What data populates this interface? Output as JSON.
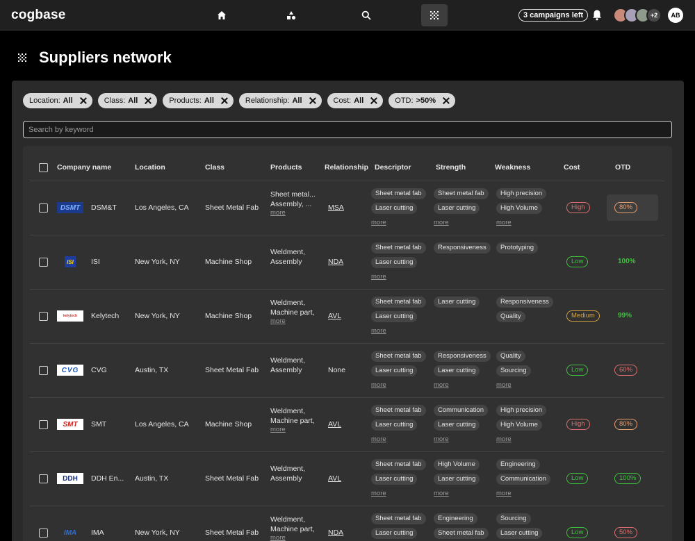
{
  "app": {
    "logo": "cogbase",
    "campaigns": "3 campaigns left",
    "avatars_more": "+2",
    "user_initials": "AB"
  },
  "page": {
    "title": "Suppliers network"
  },
  "filters": [
    {
      "label": "Location:",
      "value": "All"
    },
    {
      "label": "Class:",
      "value": "All"
    },
    {
      "label": "Products:",
      "value": "All"
    },
    {
      "label": "Relationship:",
      "value": "All"
    },
    {
      "label": "Cost:",
      "value": "All"
    },
    {
      "label": "OTD:",
      "value": ">50%"
    }
  ],
  "search": {
    "placeholder": "Search by keyword"
  },
  "columns": {
    "company": "Company name",
    "location": "Location",
    "class": "Class",
    "products": "Products",
    "relationship": "Relationship",
    "descriptor": "Descriptor",
    "strength": "Strength",
    "weakness": "Weakness",
    "cost": "Cost",
    "otd": "OTD"
  },
  "more_label": "more",
  "colors": {
    "high": "#e07070",
    "low": "#3ec23e",
    "medium": "#d6a23c",
    "otd_orange": "#e8a070",
    "otd_red": "#e07070",
    "otd_green": "#3ec23e"
  },
  "rows": [
    {
      "logo_text": "DSMT",
      "name": "DSM&T",
      "location": "Los Angeles, CA",
      "class": "Sheet Metal Fab",
      "products": [
        "Sheet metal...",
        "Assembly, ..."
      ],
      "products_more": true,
      "relationship": "MSA",
      "descriptor": [
        "Sheet metal fab",
        "Laser cutting"
      ],
      "descriptor_more": true,
      "strength": [
        "Sheet metal fab",
        "Laser cutting"
      ],
      "strength_more": true,
      "weakness": [
        "High precision",
        "High Volume"
      ],
      "weakness_more": true,
      "cost": "High",
      "otd": "80%"
    },
    {
      "logo_text": "ISI",
      "name": "ISI",
      "location": "New York, NY",
      "class": "Machine Shop",
      "products": [
        "Weldment,",
        "Assembly"
      ],
      "products_more": false,
      "relationship": "NDA",
      "descriptor": [
        "Sheet metal fab",
        "Laser cutting"
      ],
      "descriptor_more": true,
      "strength": [
        "Responsiveness"
      ],
      "strength_more": false,
      "weakness": [
        "Prototyping"
      ],
      "weakness_more": false,
      "cost": "Low",
      "otd": "100%"
    },
    {
      "logo_text": "kelytech",
      "name": "Kelytech",
      "location": "New York, NY",
      "class": "Machine Shop",
      "products": [
        "Weldment,",
        "Machine part,"
      ],
      "products_more": true,
      "relationship": "AVL",
      "descriptor": [
        "Sheet metal fab",
        "Laser cutting"
      ],
      "descriptor_more": true,
      "strength": [
        "Laser cutting"
      ],
      "strength_more": false,
      "weakness": [
        "Responsiveness",
        "Quality"
      ],
      "weakness_more": false,
      "cost": "Medium",
      "otd": "99%"
    },
    {
      "logo_text": "CVG",
      "name": "CVG",
      "location": "Austin, TX",
      "class": "Sheet Metal Fab",
      "products": [
        "Weldment,",
        "Assembly"
      ],
      "products_more": false,
      "relationship": "None",
      "descriptor": [
        "Sheet metal fab",
        "Laser cutting"
      ],
      "descriptor_more": true,
      "strength": [
        "Responsiveness",
        "Laser cutting"
      ],
      "strength_more": true,
      "weakness": [
        "Quality",
        "Sourcing"
      ],
      "weakness_more": true,
      "cost": "Low",
      "otd": "60%"
    },
    {
      "logo_text": "SMT",
      "name": "SMT",
      "location": "Los Angeles, CA",
      "class": "Machine Shop",
      "products": [
        "Weldment,",
        "Machine part,"
      ],
      "products_more": true,
      "relationship": "AVL",
      "descriptor": [
        "Sheet metal fab",
        "Laser cutting"
      ],
      "descriptor_more": true,
      "strength": [
        "Communication",
        "Laser cutting"
      ],
      "strength_more": true,
      "weakness": [
        "High precision",
        "High Volume"
      ],
      "weakness_more": true,
      "cost": "High",
      "otd": "80%"
    },
    {
      "logo_text": "DDH",
      "name": "DDH En...",
      "location": "Austin, TX",
      "class": "Sheet Metal Fab",
      "products": [
        "Weldment,",
        "Assembly"
      ],
      "products_more": false,
      "relationship": "AVL",
      "descriptor": [
        "Sheet metal fab",
        "Laser cutting"
      ],
      "descriptor_more": true,
      "strength": [
        "High Volume",
        "Laser cutting"
      ],
      "strength_more": true,
      "weakness": [
        "Engineering",
        "Communication"
      ],
      "weakness_more": true,
      "cost": "Low",
      "otd": "100%"
    },
    {
      "logo_text": "IMA",
      "name": "IMA",
      "location": "New York, NY",
      "class": "Sheet Metal Fab",
      "products": [
        "Weldment,",
        "Machine part,"
      ],
      "products_more": true,
      "relationship": "NDA",
      "descriptor": [
        "Sheet metal fab",
        "Laser cutting"
      ],
      "descriptor_more": false,
      "strength": [
        "Engineering",
        "Sheet metal fab"
      ],
      "strength_more": false,
      "weakness": [
        "Sourcing",
        "Laser cutting"
      ],
      "weakness_more": false,
      "cost": "Low",
      "otd": "50%"
    }
  ]
}
